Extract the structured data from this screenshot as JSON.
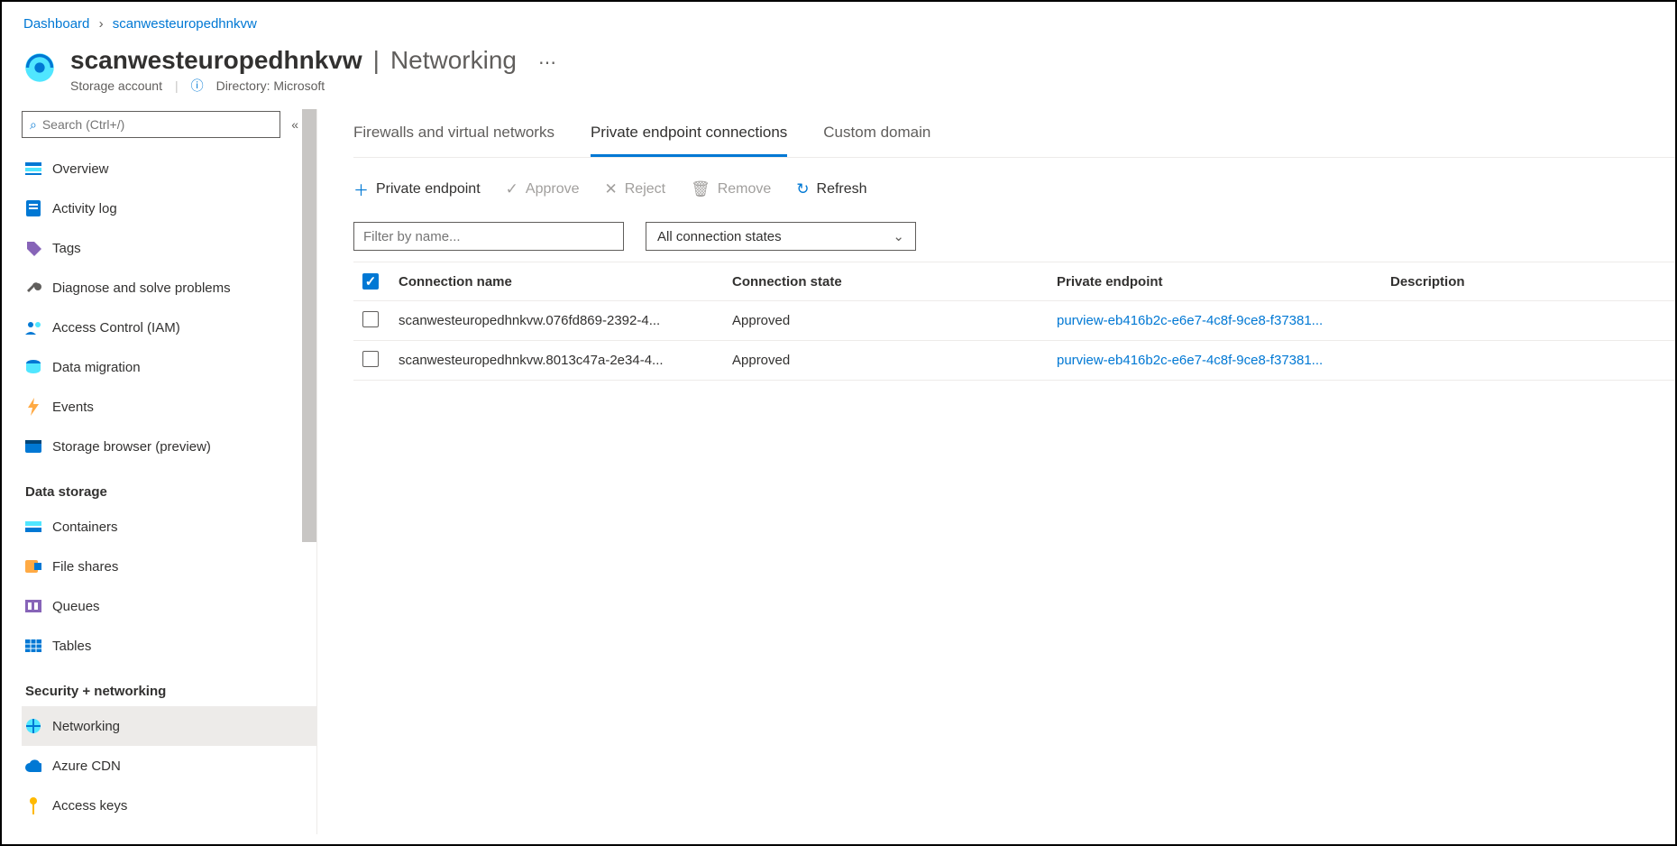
{
  "breadcrumb": {
    "root": "Dashboard",
    "current": "scanwesteuropedhnkvw"
  },
  "header": {
    "title": "scanwesteuropedhnkvw",
    "section": "Networking",
    "resource_type": "Storage account",
    "directory_label": "Directory: Microsoft"
  },
  "search": {
    "placeholder": "Search (Ctrl+/)"
  },
  "sidebar": {
    "items": [
      {
        "label": "Overview",
        "icon": "overview"
      },
      {
        "label": "Activity log",
        "icon": "log"
      },
      {
        "label": "Tags",
        "icon": "tag"
      },
      {
        "label": "Diagnose and solve problems",
        "icon": "wrench"
      },
      {
        "label": "Access Control (IAM)",
        "icon": "people"
      },
      {
        "label": "Data migration",
        "icon": "migrate"
      },
      {
        "label": "Events",
        "icon": "bolt"
      },
      {
        "label": "Storage browser (preview)",
        "icon": "browser"
      }
    ],
    "group1_title": "Data storage",
    "group1_items": [
      {
        "label": "Containers",
        "icon": "container"
      },
      {
        "label": "File shares",
        "icon": "fileshare"
      },
      {
        "label": "Queues",
        "icon": "queue"
      },
      {
        "label": "Tables",
        "icon": "table"
      }
    ],
    "group2_title": "Security + networking",
    "group2_items": [
      {
        "label": "Networking",
        "icon": "network",
        "selected": true
      },
      {
        "label": "Azure CDN",
        "icon": "cdn"
      },
      {
        "label": "Access keys",
        "icon": "key"
      }
    ]
  },
  "tabs": [
    {
      "label": "Firewalls and virtual networks"
    },
    {
      "label": "Private endpoint connections",
      "active": true
    },
    {
      "label": "Custom domain"
    }
  ],
  "toolbar": {
    "add": "Private endpoint",
    "approve": "Approve",
    "reject": "Reject",
    "remove": "Remove",
    "refresh": "Refresh"
  },
  "filters": {
    "name_placeholder": "Filter by name...",
    "state_selected": "All connection states"
  },
  "table": {
    "columns": {
      "name": "Connection name",
      "state": "Connection state",
      "endpoint": "Private endpoint",
      "desc": "Description"
    },
    "rows": [
      {
        "name": "scanwesteuropedhnkvw.076fd869-2392-4...",
        "state": "Approved",
        "endpoint": "purview-eb416b2c-e6e7-4c8f-9ce8-f37381...",
        "desc": ""
      },
      {
        "name": "scanwesteuropedhnkvw.8013c47a-2e34-4...",
        "state": "Approved",
        "endpoint": "purview-eb416b2c-e6e7-4c8f-9ce8-f37381...",
        "desc": ""
      }
    ]
  }
}
